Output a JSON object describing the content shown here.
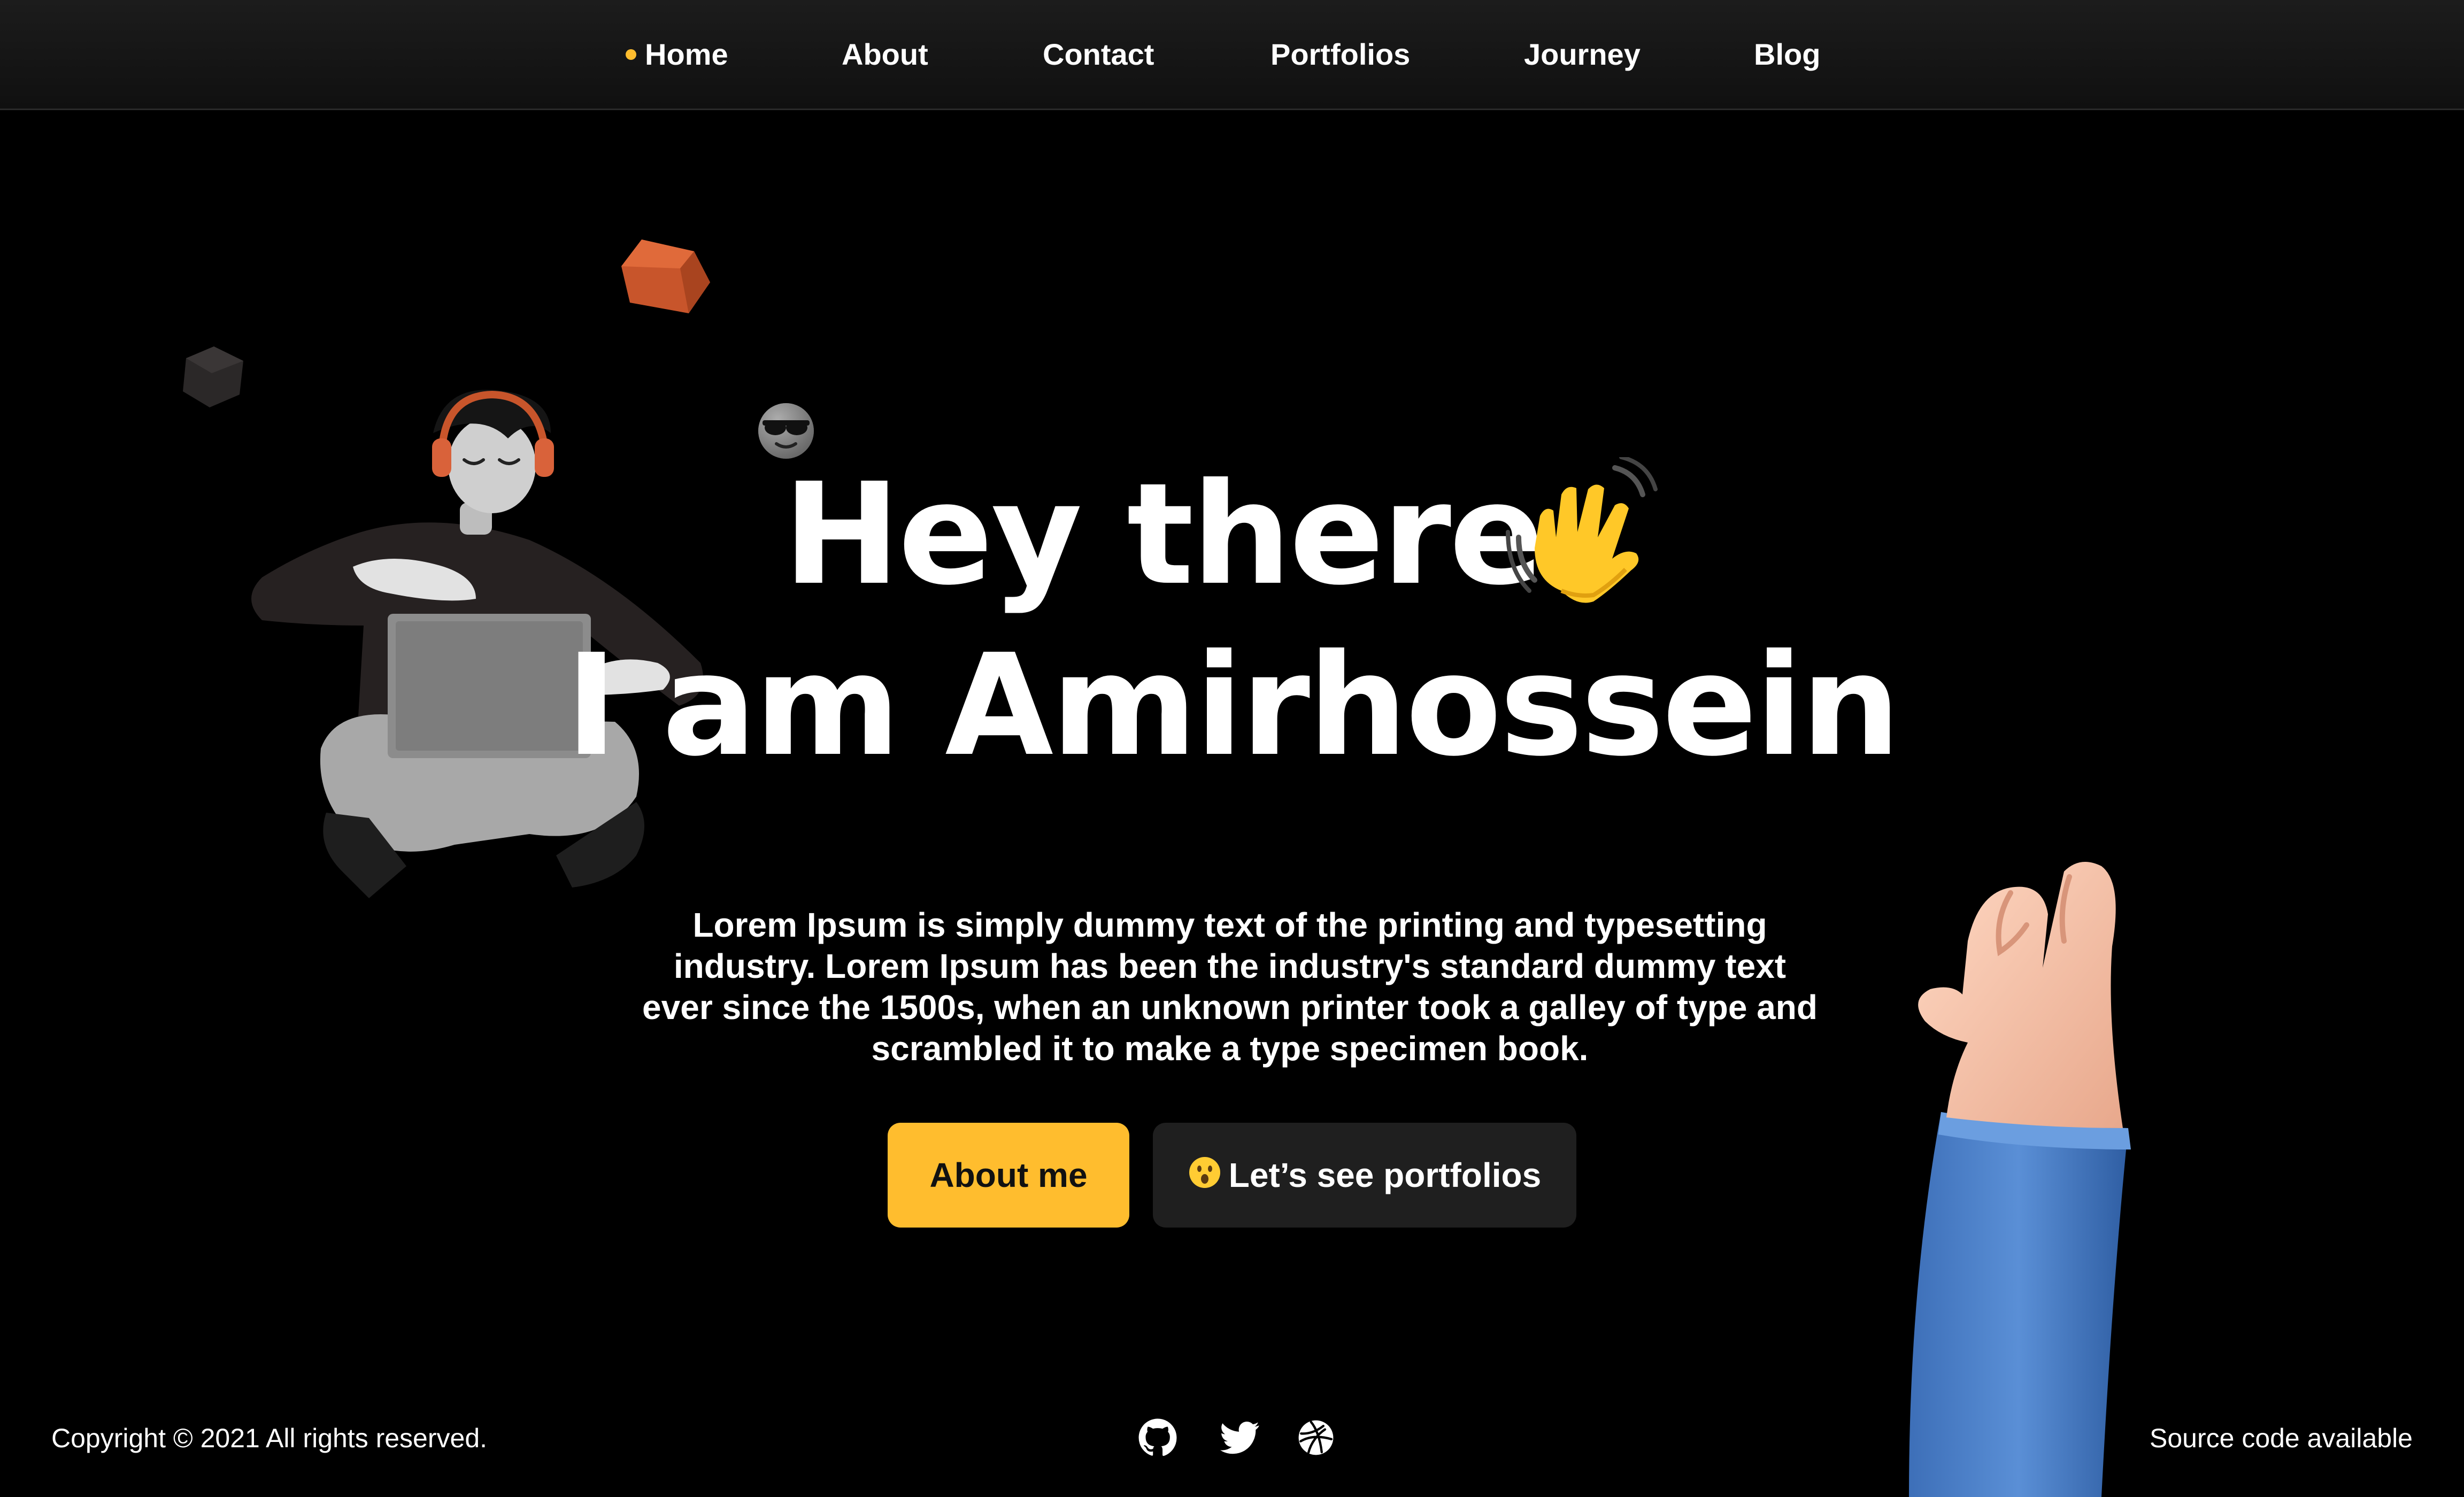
{
  "nav": {
    "items": [
      {
        "label": "Home",
        "active": true
      },
      {
        "label": "About",
        "active": false
      },
      {
        "label": "Contact",
        "active": false
      },
      {
        "label": "Portfolios",
        "active": false
      },
      {
        "label": "Journey",
        "active": false
      },
      {
        "label": "Blog",
        "active": false
      }
    ],
    "active_indicator_color": "#ffbd2e"
  },
  "hero": {
    "line1": "Hey there",
    "line1_icon": "waving-hand-icon",
    "line2": "I am Amirhossein",
    "description": "Lorem Ipsum is simply dummy text of the printing and typesetting industry. Lorem Ipsum has been the industry's standard dummy text ever since the 1500s, when an unknown printer took a galley of type and scrambled it to make a type specimen book.",
    "buttons": {
      "about_label": "About me",
      "portfolio_label": "Let’s see portfolios",
      "portfolio_icon": "surprised-face-icon"
    }
  },
  "footer": {
    "copyright": "Copyright © 2021 All rights reserved.",
    "source": "Source code available",
    "social": [
      "github-icon",
      "twitter-icon",
      "dribbble-icon"
    ]
  },
  "colors": {
    "background": "#000000",
    "accent": "#ffbd2e",
    "secondary_button": "#1f1f1f",
    "text": "#ffffff"
  }
}
